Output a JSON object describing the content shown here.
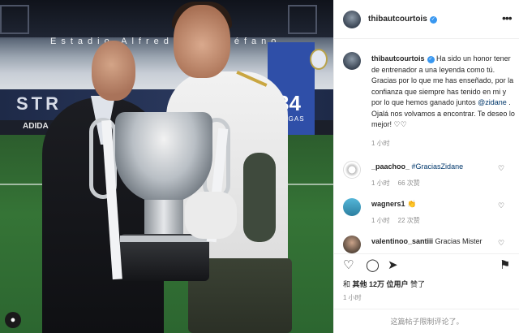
{
  "photo": {
    "stadium_text": "Estadio Alfredo Di Stéfano",
    "band_text": "STR",
    "ad_text": "ADIDA",
    "banner_number": "34",
    "banner_label": "LIGAS"
  },
  "header": {
    "username": "thibautcourtois",
    "more_label": "•••"
  },
  "caption": {
    "username": "thibautcourtois",
    "text_before_mention": "Ha sido un honor tener de entrenador a una leyenda como tú. Gracias por lo que me has enseñado, por la confianza que siempre has tenido en mi y por lo que hemos ganado juntos ",
    "mention": "@zidane",
    "text_after_mention": " . Ojalá nos volvamos a encontrar. Te deseo lo mejor! ♡♡",
    "time": "1 小时"
  },
  "comments": [
    {
      "username": "_paachoo_",
      "text": "#GraciasZidane",
      "time": "1 小时",
      "likes": "66 次赞"
    },
    {
      "username": "wagners1",
      "text": "👏",
      "time": "1 小时",
      "likes": "22 次赞"
    },
    {
      "username": "valentinoo_santiii",
      "text": "Gracias Mister"
    }
  ],
  "likes": {
    "prefix": "和 ",
    "others": "其他 12万 位用户",
    "suffix": " 赞了"
  },
  "post_time": "1 小时",
  "footer": "这篇帖子限制评论了。"
}
